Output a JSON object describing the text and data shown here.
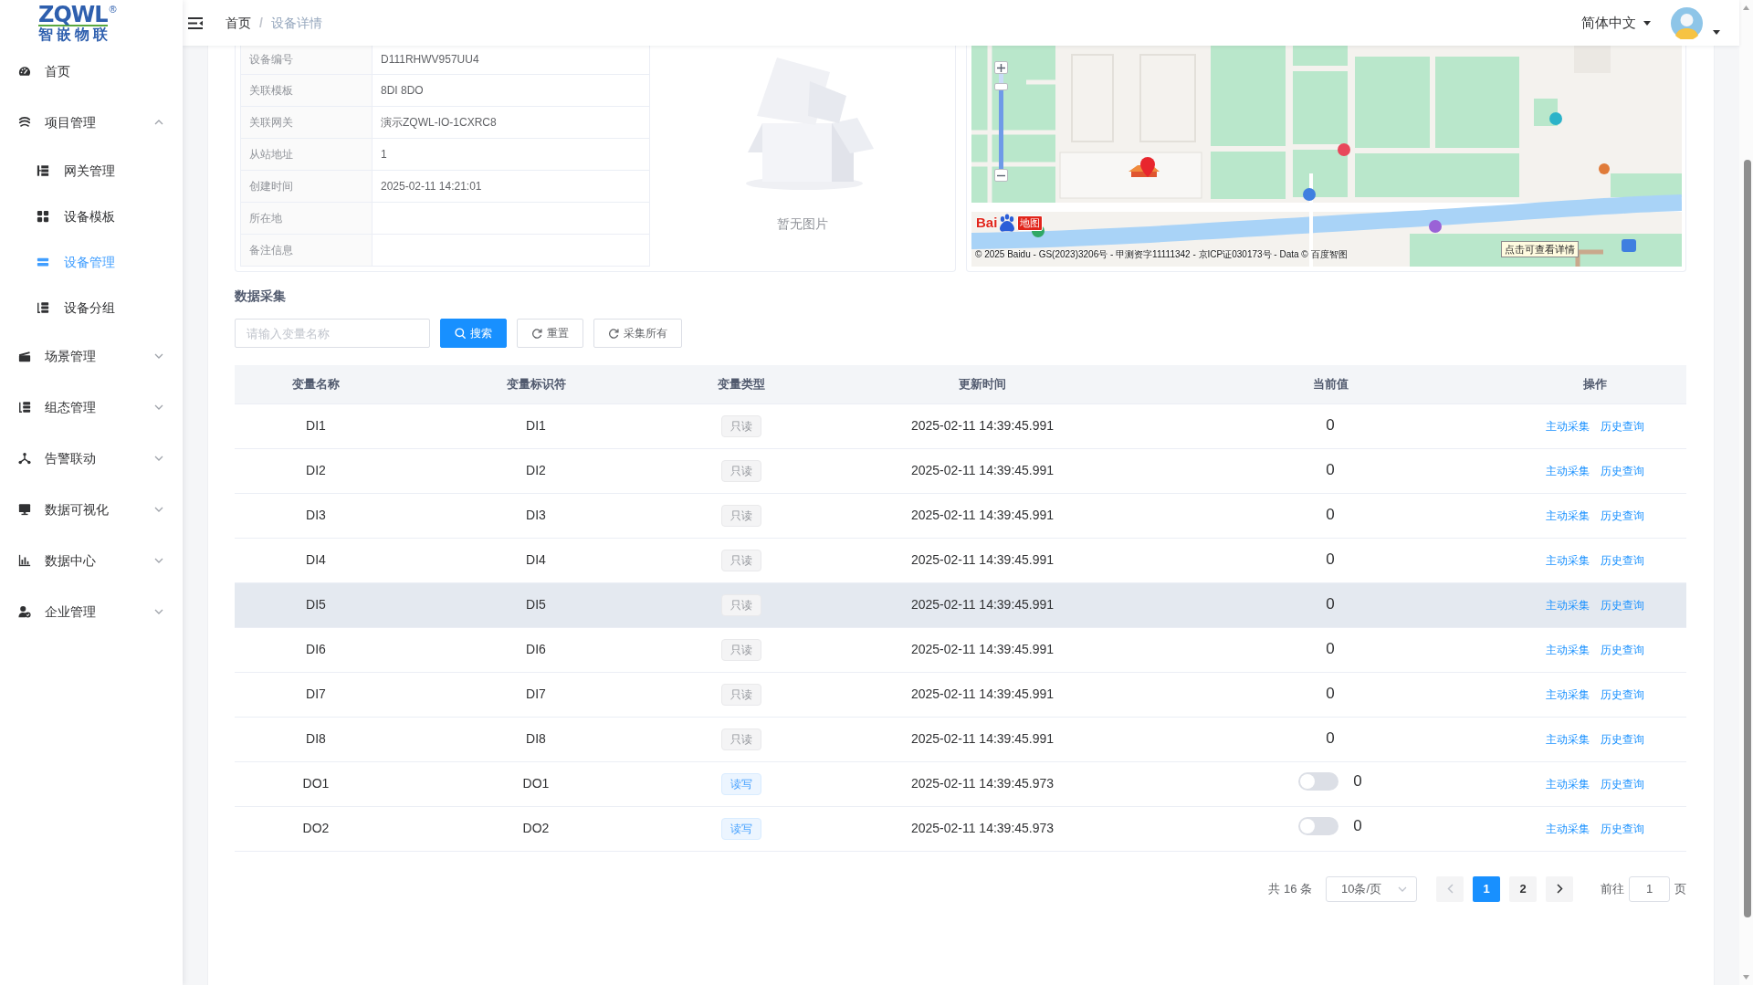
{
  "logo": {
    "mark": "ZQWL",
    "registered": "®",
    "tagline": "智嵌物联"
  },
  "sidebar": {
    "items": [
      {
        "label": "首页",
        "kind": "link",
        "selected": false
      },
      {
        "label": "项目管理",
        "kind": "group",
        "expanded": true,
        "selected": false,
        "children": [
          {
            "label": "网关管理",
            "selected": false
          },
          {
            "label": "设备模板",
            "selected": false
          },
          {
            "label": "设备管理",
            "selected": true
          },
          {
            "label": "设备分组",
            "selected": false
          }
        ]
      },
      {
        "label": "场景管理",
        "kind": "group",
        "expanded": false,
        "selected": false
      },
      {
        "label": "组态管理",
        "kind": "group",
        "expanded": false,
        "selected": false
      },
      {
        "label": "告警联动",
        "kind": "group",
        "expanded": false,
        "selected": false
      },
      {
        "label": "数据可视化",
        "kind": "group",
        "expanded": false,
        "selected": false
      },
      {
        "label": "数据中心",
        "kind": "group",
        "expanded": false,
        "selected": false
      },
      {
        "label": "企业管理",
        "kind": "group",
        "expanded": false,
        "selected": false
      }
    ]
  },
  "header": {
    "breadcrumb": {
      "separator": "/",
      "items": [
        {
          "label": "首页",
          "current": false
        },
        {
          "label": "设备详情",
          "current": true
        }
      ]
    },
    "language": "简体中文"
  },
  "device_info": {
    "fields": [
      {
        "label": "设备编号",
        "value": "D111RHWV957UU4"
      },
      {
        "label": "关联模板",
        "value": "8DI 8DO"
      },
      {
        "label": "关联网关",
        "value": "演示ZQWL-IO-1CXRC8"
      },
      {
        "label": "从站地址",
        "value": "1"
      },
      {
        "label": "创建时间",
        "value": "2025-02-11 14:21:01"
      },
      {
        "label": "所在地"
      },
      {
        "label": "备注信息"
      }
    ],
    "image": {
      "empty_text": "暂无图片"
    }
  },
  "map": {
    "zoom": {
      "level": 0.9
    },
    "logo": {
      "left": "Bai",
      "right": "地图"
    },
    "copyright": "© 2025 Baidu - GS(2023)3206号 - 甲测资字11111342 - 京ICP证030173号 - Data © 百度智图",
    "tooltip": "点击可查看详情"
  },
  "data_collection": {
    "title": "数据采集",
    "search": {
      "placeholder": "请输入变量名称"
    },
    "buttons": [
      {
        "label": "搜索",
        "kind": "search"
      },
      {
        "label": "重置",
        "kind": "reset"
      },
      {
        "label": "采集所有",
        "kind": "collect"
      }
    ],
    "table": {
      "columns": [
        "变量名称",
        "变量标识符",
        "变量类型",
        "更新时间",
        "当前值",
        "操作"
      ],
      "rows": [
        {
          "name": "DI1",
          "identifier": "DI1",
          "type": {
            "label": "只读",
            "kind": "readonly"
          },
          "updated": "2025-02-11 14:39:45.991",
          "value": {
            "kind": "plain",
            "text": "0"
          },
          "actions": [
            "主动采集",
            "历史查询"
          ],
          "hovered": false
        },
        {
          "name": "DI2",
          "identifier": "DI2",
          "type": {
            "label": "只读",
            "kind": "readonly"
          },
          "updated": "2025-02-11 14:39:45.991",
          "value": {
            "kind": "plain",
            "text": "0"
          },
          "actions": [
            "主动采集",
            "历史查询"
          ],
          "hovered": false
        },
        {
          "name": "DI3",
          "identifier": "DI3",
          "type": {
            "label": "只读",
            "kind": "readonly"
          },
          "updated": "2025-02-11 14:39:45.991",
          "value": {
            "kind": "plain",
            "text": "0"
          },
          "actions": [
            "主动采集",
            "历史查询"
          ],
          "hovered": false
        },
        {
          "name": "DI4",
          "identifier": "DI4",
          "type": {
            "label": "只读",
            "kind": "readonly"
          },
          "updated": "2025-02-11 14:39:45.991",
          "value": {
            "kind": "plain",
            "text": "0"
          },
          "actions": [
            "主动采集",
            "历史查询"
          ],
          "hovered": false
        },
        {
          "name": "DI5",
          "identifier": "DI5",
          "type": {
            "label": "只读",
            "kind": "readonly"
          },
          "updated": "2025-02-11 14:39:45.991",
          "value": {
            "kind": "plain",
            "text": "0"
          },
          "actions": [
            "主动采集",
            "历史查询"
          ],
          "hovered": true
        },
        {
          "name": "DI6",
          "identifier": "DI6",
          "type": {
            "label": "只读",
            "kind": "readonly"
          },
          "updated": "2025-02-11 14:39:45.991",
          "value": {
            "kind": "plain",
            "text": "0"
          },
          "actions": [
            "主动采集",
            "历史查询"
          ],
          "hovered": false
        },
        {
          "name": "DI7",
          "identifier": "DI7",
          "type": {
            "label": "只读",
            "kind": "readonly"
          },
          "updated": "2025-02-11 14:39:45.991",
          "value": {
            "kind": "plain",
            "text": "0"
          },
          "actions": [
            "主动采集",
            "历史查询"
          ],
          "hovered": false
        },
        {
          "name": "DI8",
          "identifier": "DI8",
          "type": {
            "label": "只读",
            "kind": "readonly"
          },
          "updated": "2025-02-11 14:39:45.991",
          "value": {
            "kind": "plain",
            "text": "0"
          },
          "actions": [
            "主动采集",
            "历史查询"
          ],
          "hovered": false
        },
        {
          "name": "DO1",
          "identifier": "DO1",
          "type": {
            "label": "读写",
            "kind": "readwrite"
          },
          "updated": "2025-02-11 14:39:45.973",
          "value": {
            "kind": "switch",
            "on": false,
            "text": "0"
          },
          "actions": [
            "主动采集",
            "历史查询"
          ],
          "hovered": false
        },
        {
          "name": "DO2",
          "identifier": "DO2",
          "type": {
            "label": "读写",
            "kind": "readwrite"
          },
          "updated": "2025-02-11 14:39:45.973",
          "value": {
            "kind": "switch",
            "on": false,
            "text": "0"
          },
          "actions": [
            "主动采集",
            "历史查询"
          ],
          "hovered": false
        }
      ]
    },
    "pagination": {
      "total": "共 16 条",
      "page_size": "10条/页",
      "prev": {
        "disabled": true
      },
      "pages": [
        {
          "label": "1",
          "selected": true
        },
        {
          "label": "2",
          "selected": false
        }
      ],
      "next": {
        "disabled": false
      },
      "goto_label": "前往",
      "goto_value": "1",
      "goto_suffix": "页"
    }
  }
}
